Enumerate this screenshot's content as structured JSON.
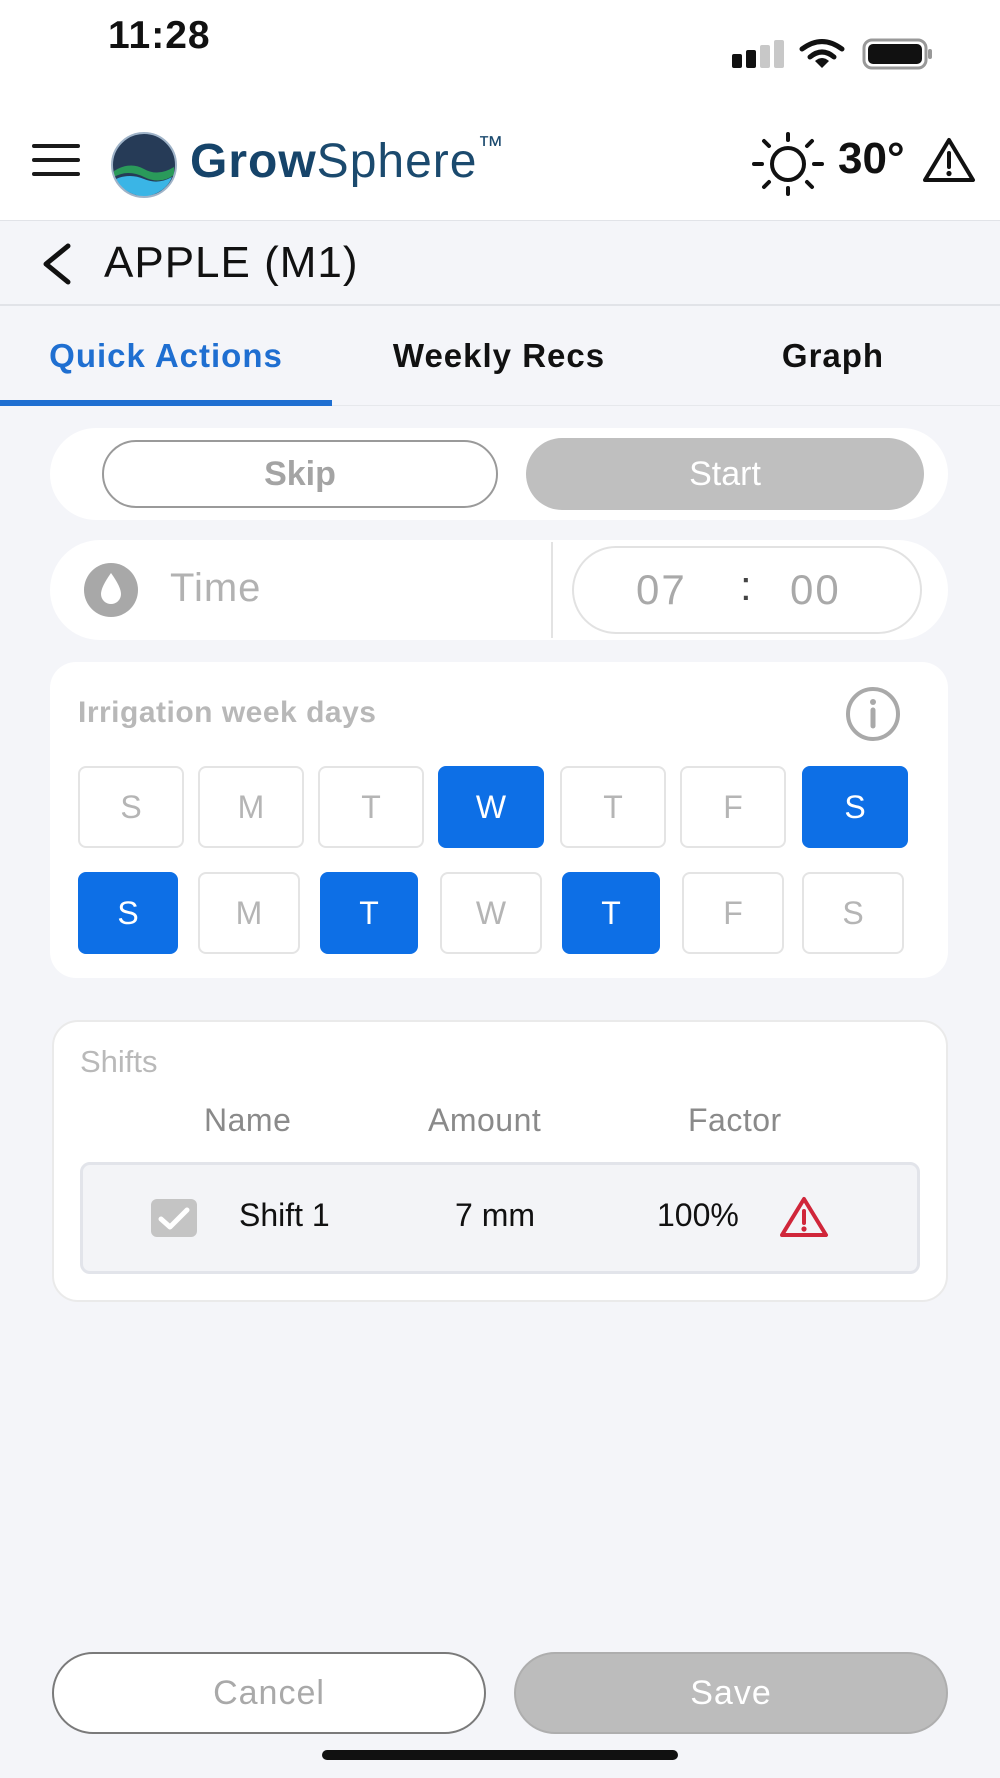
{
  "status_bar": {
    "time": "11:28"
  },
  "header": {
    "brand_bold": "Grow",
    "brand_light": "Sphere",
    "brand_mark": "™",
    "temperature": "30°",
    "icons": [
      "menu-icon",
      "logo-icon",
      "sun-icon",
      "warning-icon"
    ]
  },
  "title_bar": {
    "title": "APPLE (M1)"
  },
  "tabs": [
    {
      "label": "Quick Actions",
      "active": true
    },
    {
      "label": "Weekly Recs",
      "active": false
    },
    {
      "label": "Graph",
      "active": false
    }
  ],
  "quick_actions": {
    "skip_label": "Skip",
    "start_label": "Start"
  },
  "time_setting": {
    "label": "Time",
    "hours": "07",
    "separator": ":",
    "minutes": "00"
  },
  "weekdays": {
    "title": "Irrigation week days",
    "rows": [
      [
        {
          "label": "S",
          "selected": false
        },
        {
          "label": "M",
          "selected": false
        },
        {
          "label": "T",
          "selected": false
        },
        {
          "label": "W",
          "selected": true
        },
        {
          "label": "T",
          "selected": false
        },
        {
          "label": "F",
          "selected": false
        },
        {
          "label": "S",
          "selected": true
        }
      ],
      [
        {
          "label": "S",
          "selected": true
        },
        {
          "label": "M",
          "selected": false
        },
        {
          "label": "T",
          "selected": true
        },
        {
          "label": "W",
          "selected": false
        },
        {
          "label": "T",
          "selected": true
        },
        {
          "label": "F",
          "selected": false
        },
        {
          "label": "S",
          "selected": false
        }
      ]
    ]
  },
  "shifts": {
    "title": "Shifts",
    "columns": [
      "Name",
      "Amount",
      "Factor"
    ],
    "rows": [
      {
        "checked": true,
        "name": "Shift 1",
        "amount": "7 mm",
        "factor": "100%",
        "warning": true
      }
    ]
  },
  "footer": {
    "cancel_label": "Cancel",
    "save_label": "Save"
  },
  "colors": {
    "accent": "#1f6fd1",
    "selected_day": "#0d6fe6",
    "warning": "#d0263a",
    "disabled": "#bfbfbf",
    "brand": "#1b4a6e"
  }
}
